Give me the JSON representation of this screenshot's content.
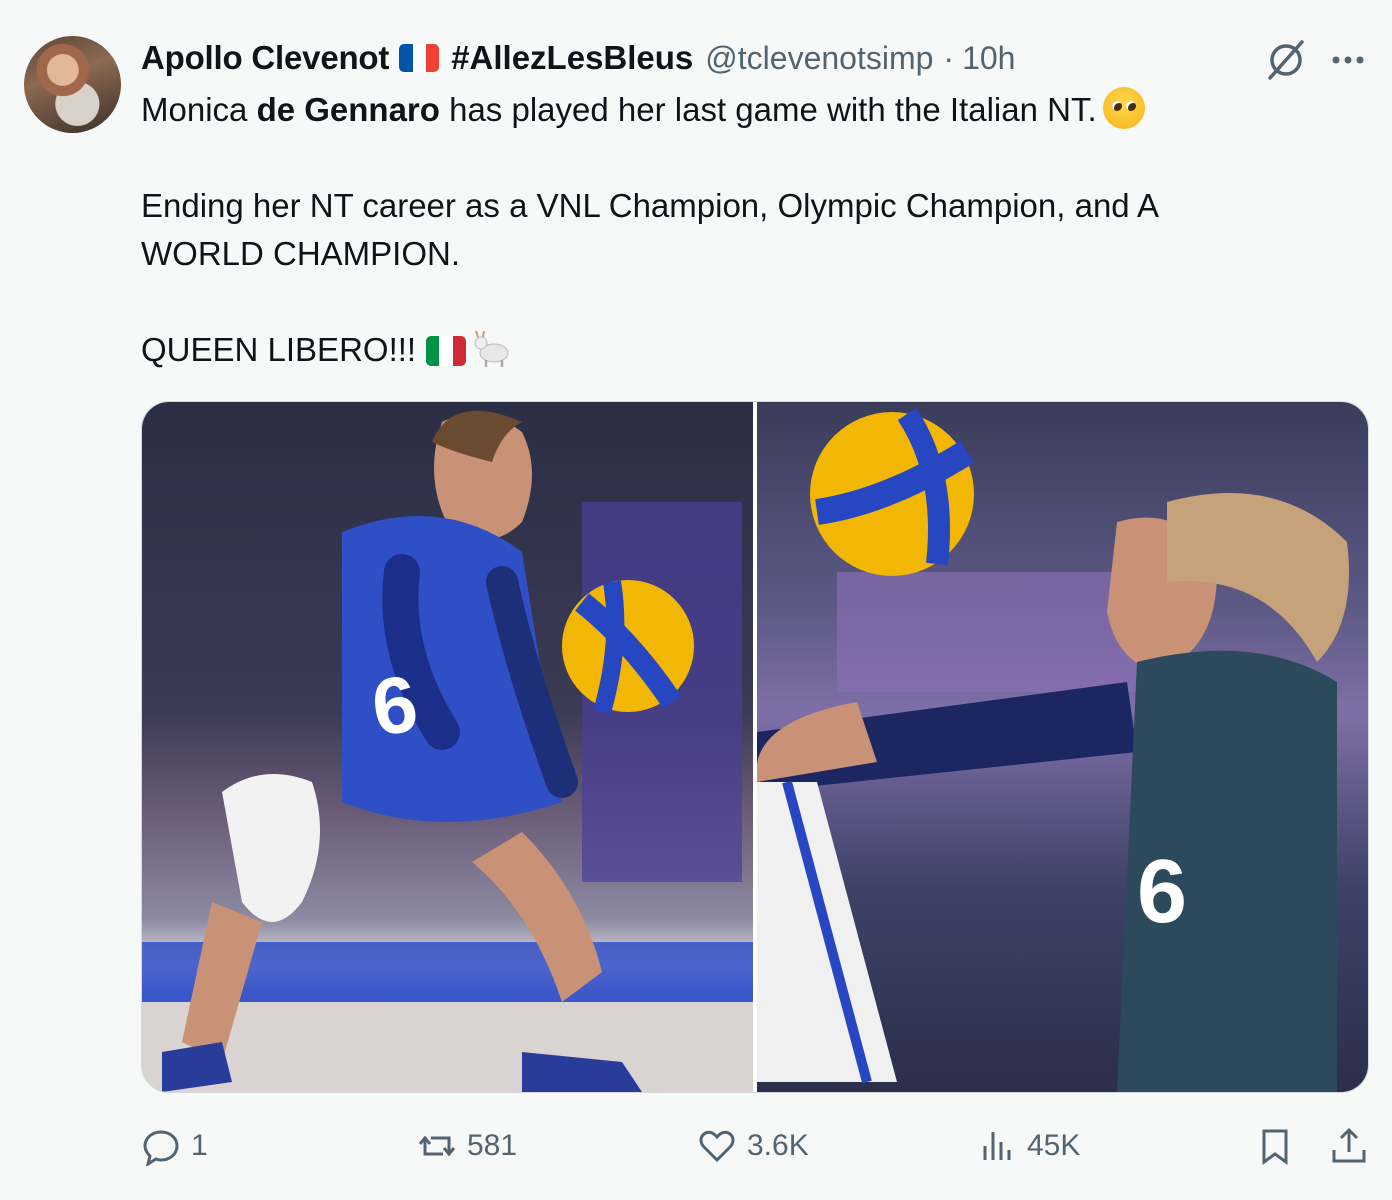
{
  "author": {
    "name": "Apollo Clevenot",
    "hashtag": "#AllezLesBleus",
    "handle": "@tclevenotsimp",
    "separator": "·",
    "time": "10h"
  },
  "tweet": {
    "line1_pre": "Monica ",
    "line1_bold": "de Gennaro",
    "line1_post": " has played her last game with the Italian NT.",
    "para2": "Ending her NT career as a VNL Champion, Olympic Champion, and A WORLD CHAMPION.",
    "para3": "QUEEN LIBERO!!!"
  },
  "media": {
    "photo1": {
      "jersey_number": "6"
    },
    "photo2": {
      "jersey_number": "6"
    }
  },
  "stats": {
    "replies": "1",
    "reposts": "581",
    "likes": "3.6K",
    "views": "45K"
  },
  "colors": {
    "accent": "#1d9bf0",
    "muted": "#536471",
    "flag_fr": [
      "#0055a4",
      "#ffffff",
      "#ef4135"
    ],
    "flag_it": [
      "#009246",
      "#ffffff",
      "#ce2b37"
    ]
  },
  "icons": [
    "grok-icon",
    "more-icon",
    "reply-icon",
    "repost-icon",
    "like-icon",
    "views-icon",
    "bookmark-icon",
    "share-icon"
  ]
}
